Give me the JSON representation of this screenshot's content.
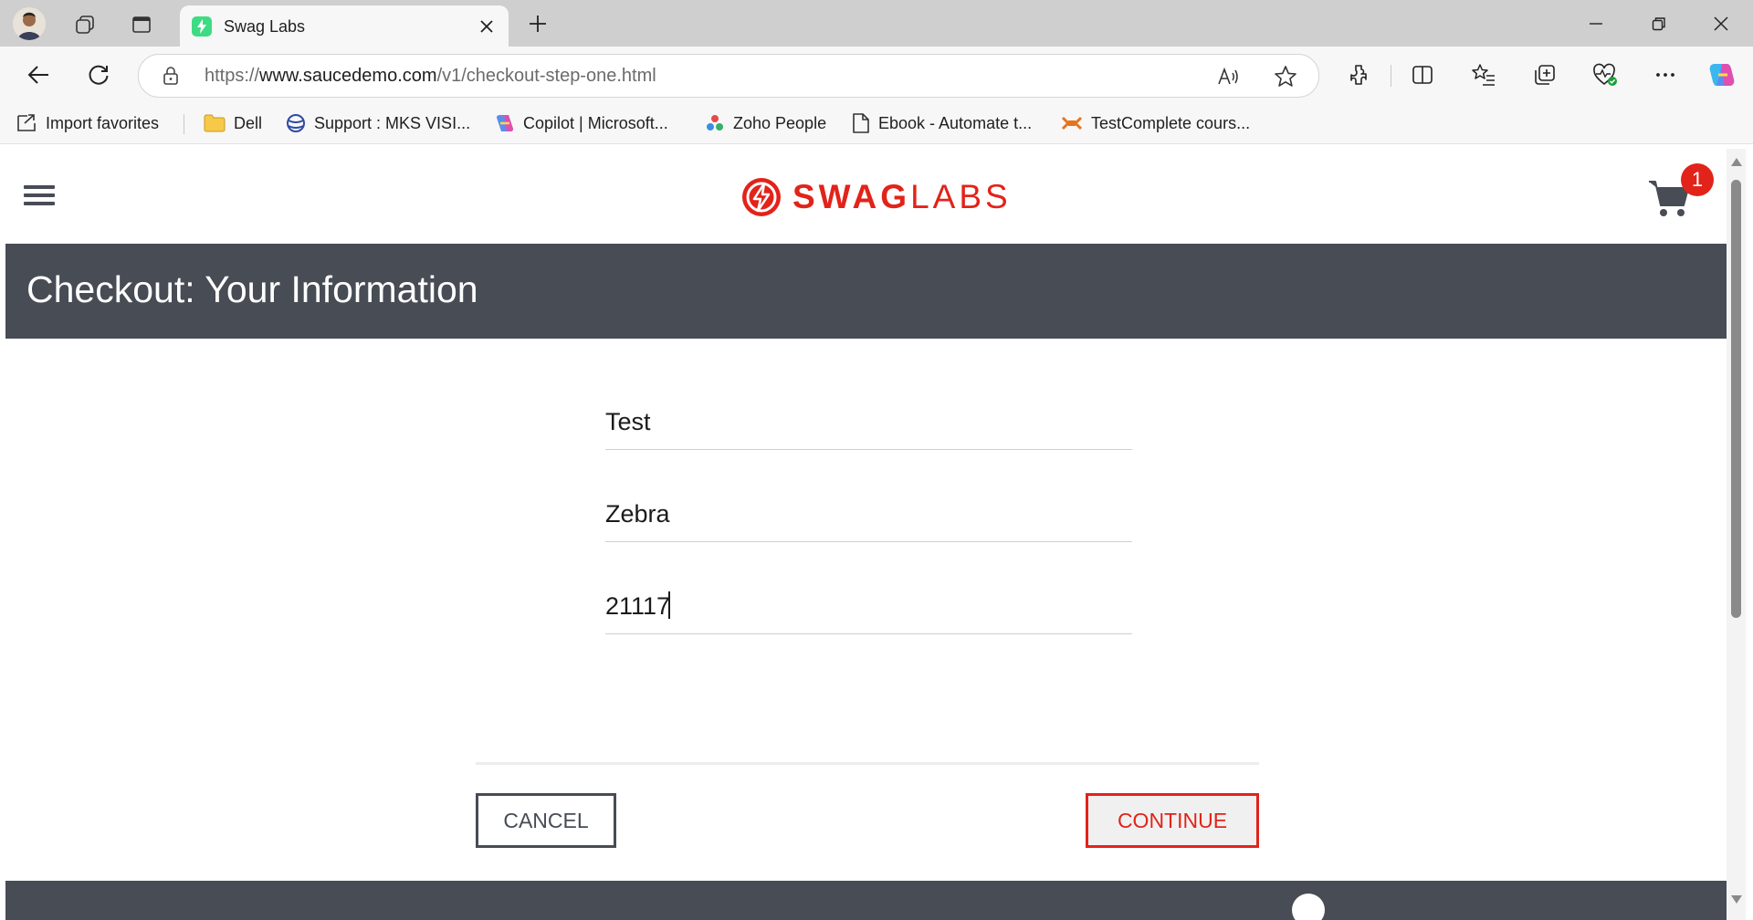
{
  "browser": {
    "tab_title": "Swag Labs",
    "url_prefix": "https://",
    "url_host": "www.saucedemo.com",
    "url_path": "/v1/checkout-step-one.html",
    "bookmarks": [
      "Import favorites",
      "Dell",
      "Support : MKS VISI...",
      "Copilot | Microsoft...",
      "Zoho People",
      "Ebook - Automate t...",
      "TestComplete cours..."
    ]
  },
  "app": {
    "logo_bold": "SWAG",
    "logo_light": "LABS",
    "cart_count": "1",
    "page_title": "Checkout: Your Information",
    "form": {
      "first_name": "Test",
      "last_name": "Zebra",
      "postal_code": "21117"
    },
    "cancel_label": "CANCEL",
    "continue_label": "CONTINUE"
  },
  "colors": {
    "brand_red": "#e2231a",
    "dark_bar": "#474c55",
    "chrome_bg": "#cfcfcf"
  }
}
